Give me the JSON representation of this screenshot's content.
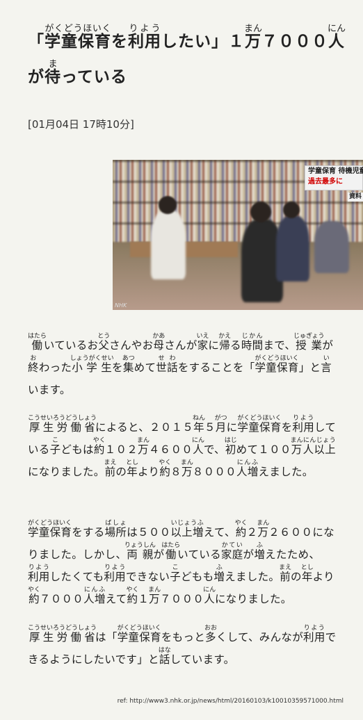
{
  "article": {
    "title_parts": [
      {
        "t": "「"
      },
      {
        "t": "学童保育",
        "r": "がくどうほいく"
      },
      {
        "t": "を"
      },
      {
        "t": "利用",
        "r": "りよう"
      },
      {
        "t": "したい」１"
      },
      {
        "t": "万",
        "r": "まん"
      },
      {
        "t": "７０"
      },
      {
        "t": "００"
      },
      {
        "t": "人",
        "r": "にん"
      },
      {
        "t": "が"
      },
      {
        "t": "待",
        "r": "ま"
      },
      {
        "t": "っている"
      }
    ],
    "dateline": "[01月04日 17時10分]"
  },
  "photo": {
    "caption_line1": "学童保育 待機児童",
    "caption_line2": "過去最多に",
    "caption_sub": "資料",
    "watermark": "NHK"
  },
  "paragraphs": [
    [
      {
        "t": "働",
        "r": "はたら"
      },
      {
        "t": "いているお"
      },
      {
        "t": "父",
        "r": "とう"
      },
      {
        "t": "さんやお"
      },
      {
        "t": "母",
        "r": "かあ"
      },
      {
        "t": "さんが"
      },
      {
        "t": "家",
        "r": "いえ"
      },
      {
        "t": "に"
      },
      {
        "t": "帰",
        "r": "かえ"
      },
      {
        "t": "る"
      },
      {
        "t": "時間",
        "r": "じかん"
      },
      {
        "t": "まで、"
      },
      {
        "t": "授業",
        "r": "じゅぎょう"
      },
      {
        "t": "が"
      },
      {
        "t": "終",
        "r": "お"
      },
      {
        "t": "わった"
      },
      {
        "t": "小学生",
        "r": "しょうがくせい"
      },
      {
        "t": "を"
      },
      {
        "t": "集",
        "r": "あつ"
      },
      {
        "t": "めて"
      },
      {
        "t": "世話",
        "r": "せわ"
      },
      {
        "t": "をすることを「"
      },
      {
        "t": "学童保育",
        "r": "がくどうほいく"
      },
      {
        "t": "」と"
      },
      {
        "t": "言",
        "r": "い"
      },
      {
        "t": "います。"
      }
    ],
    [
      {
        "t": "厚生労働省",
        "r": "こうせいろうどうしょう"
      },
      {
        "t": "によると、２０１５"
      },
      {
        "t": "年",
        "r": "ねん"
      },
      {
        "t": "５"
      },
      {
        "t": "月",
        "r": "がつ"
      },
      {
        "t": "に"
      },
      {
        "t": "学童保育",
        "r": "がくどうほいく"
      },
      {
        "t": "を"
      },
      {
        "t": "利用",
        "r": "りよう"
      },
      {
        "t": "している"
      },
      {
        "t": "子",
        "r": "こ"
      },
      {
        "t": "どもは"
      },
      {
        "t": "約",
        "r": "やく"
      },
      {
        "t": "１０２"
      },
      {
        "t": "万",
        "r": "まん"
      },
      {
        "t": "４６００"
      },
      {
        "t": "人",
        "r": "にん"
      },
      {
        "t": "で、"
      },
      {
        "t": "初",
        "r": "はじ"
      },
      {
        "t": "めて１００"
      },
      {
        "t": "万",
        "r": "まん"
      },
      {
        "t": "人以上",
        "r": "にんじょう"
      },
      {
        "t": "になりました。"
      },
      {
        "t": "前",
        "r": "まえ"
      },
      {
        "t": "の"
      },
      {
        "t": "年",
        "r": "とし"
      },
      {
        "t": "より"
      },
      {
        "t": "約",
        "r": "やく"
      },
      {
        "t": "８"
      },
      {
        "t": "万",
        "r": "まん"
      },
      {
        "t": "８０００"
      },
      {
        "t": "人増",
        "r": "にんふ"
      },
      {
        "t": "えました。"
      }
    ],
    [
      {
        "t": "学童保育",
        "r": "がくどうほいく"
      },
      {
        "t": "をする"
      },
      {
        "t": "場所",
        "r": "ばしょ"
      },
      {
        "t": "は５００"
      },
      {
        "t": "以上増",
        "r": "いじょうふ"
      },
      {
        "t": "えて、"
      },
      {
        "t": "約",
        "r": "やく"
      },
      {
        "t": "２"
      },
      {
        "t": "万",
        "r": "まん"
      },
      {
        "t": "２６００に"
      },
      {
        "t": "なりました。しかし、"
      },
      {
        "t": "両親",
        "r": "りょうしん"
      },
      {
        "t": "が"
      },
      {
        "t": "働",
        "r": "はたら"
      },
      {
        "t": "いている"
      },
      {
        "t": "家庭",
        "r": "かてい"
      },
      {
        "t": "が"
      },
      {
        "t": "増",
        "r": "ふ"
      },
      {
        "t": "えたため、"
      },
      {
        "t": "利用",
        "r": "りよう"
      },
      {
        "t": "したくても"
      },
      {
        "t": "利用",
        "r": "りよう"
      },
      {
        "t": "できない"
      },
      {
        "t": "子",
        "r": "こ"
      },
      {
        "t": "どもも"
      },
      {
        "t": "増",
        "r": "ふ"
      },
      {
        "t": "えました。"
      },
      {
        "t": "前",
        "r": "まえ"
      },
      {
        "t": "の"
      },
      {
        "t": "年",
        "r": "とし"
      },
      {
        "t": "より"
      },
      {
        "t": "約",
        "r": "やく"
      },
      {
        "t": "７０００"
      },
      {
        "t": "人増",
        "r": "にんふ"
      },
      {
        "t": "えて"
      },
      {
        "t": "約",
        "r": "やく"
      },
      {
        "t": "１"
      },
      {
        "t": "万",
        "r": "まん"
      },
      {
        "t": "７０００"
      },
      {
        "t": "人",
        "r": "にん"
      },
      {
        "t": "になりました。"
      }
    ],
    [
      {
        "t": "厚生労働省",
        "r": "こうせいろうどうしょう"
      },
      {
        "t": "は「"
      },
      {
        "t": "学童保育",
        "r": "がくどうほいく"
      },
      {
        "t": "をもっと"
      },
      {
        "t": "多",
        "r": "おお"
      },
      {
        "t": "くして、みんなが"
      },
      {
        "t": "利用",
        "r": "りよう"
      },
      {
        "t": "できるようにしたいです」と"
      },
      {
        "t": "話",
        "r": "はな"
      },
      {
        "t": "しています。"
      }
    ]
  ],
  "ref": "ref: http://www3.nhk.or.jp/news/html/20160103/k10010359571000.html"
}
